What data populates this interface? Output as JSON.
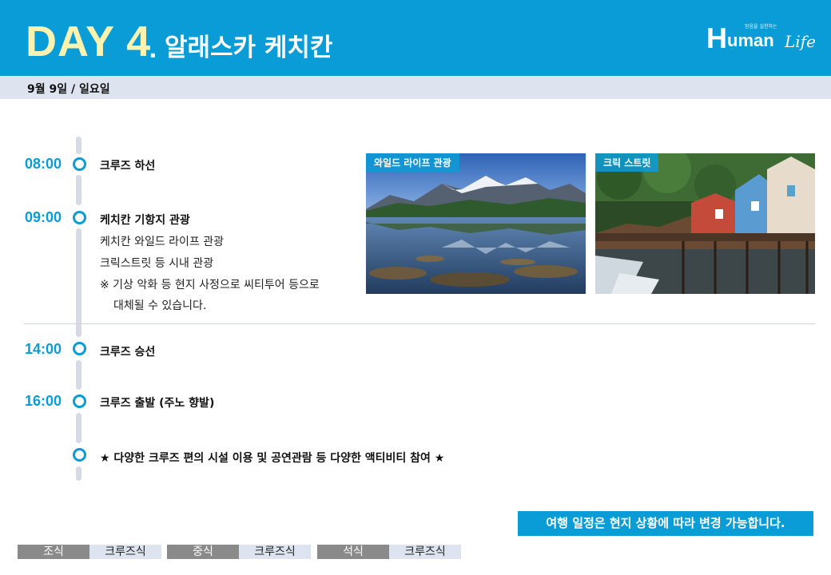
{
  "header": {
    "day_label": "DAY",
    "day_number": "4",
    "separator": ".",
    "place": "알래스카 케치칸",
    "logo": {
      "letter": "H",
      "word": "uman",
      "script": "Life",
      "tagline": "믿음을 실천하는"
    }
  },
  "date": "9월 9일 / 일요일",
  "schedule": [
    {
      "time": "08:00",
      "lines": [
        "크루즈 하선"
      ]
    },
    {
      "time": "09:00",
      "lines": [
        "케치칸 기항지 관광",
        "케치칸 와일드 라이프 관광",
        "크릭스트릿 등 시내 관광",
        "※ 기상 악화 등 현지 사정으로 씨티투어 등으로",
        "대체될 수 있습니다."
      ]
    },
    {
      "time": "14:00",
      "lines": [
        "크루즈 승선"
      ]
    },
    {
      "time": "16:00",
      "lines": [
        "크루즈 출발 (주노 향발)"
      ]
    },
    {
      "time": "",
      "lines": [
        "★ 다양한 크루즈 편의 시설 이용 및 공연관람 등 다양한 액티비티 참여 ★"
      ]
    }
  ],
  "photos": [
    {
      "caption": "와일드 라이프 관광"
    },
    {
      "caption": "크릭 스트릿"
    }
  ],
  "notice": "여행 일정은 현지 상황에 따라 변경 가능합니다.",
  "meals": [
    {
      "label": "조식",
      "value": "크루즈식"
    },
    {
      "label": "중식",
      "value": "크루즈식"
    },
    {
      "label": "석식",
      "value": "크루즈식"
    }
  ],
  "colors": {
    "accent": "#0a9cd6",
    "title_yellow": "#fcf2b0",
    "date_bar": "#dde4ef",
    "meal_label": "#8a8a8a"
  }
}
